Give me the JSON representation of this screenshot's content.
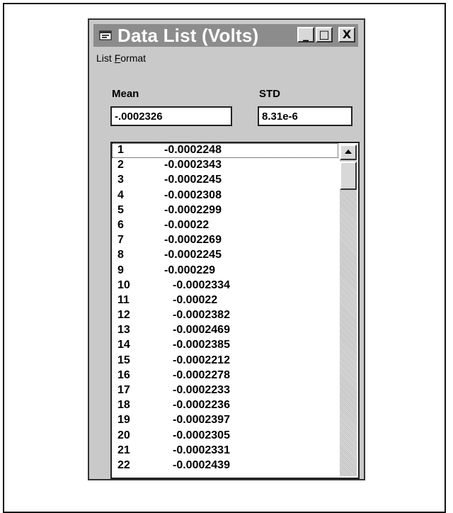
{
  "window": {
    "title": "Data List (Volts)",
    "controls": {
      "minimize": "_",
      "maximize": "□",
      "close": "X"
    }
  },
  "menu": {
    "list": "List",
    "format_prefix": "F",
    "format_rest": "ormat"
  },
  "stats": {
    "mean_label": "Mean",
    "mean_value": "-.0002326",
    "std_label": "STD",
    "std_value": "8.31e-6"
  },
  "list": {
    "rows": [
      {
        "index": "1",
        "value": "-0.0002248"
      },
      {
        "index": "2",
        "value": "-0.0002343"
      },
      {
        "index": "3",
        "value": "-0.0002245"
      },
      {
        "index": "4",
        "value": "-0.0002308"
      },
      {
        "index": "5",
        "value": "-0.0002299"
      },
      {
        "index": "6",
        "value": "-0.00022"
      },
      {
        "index": "7",
        "value": "-0.0002269"
      },
      {
        "index": "8",
        "value": "-0.0002245"
      },
      {
        "index": "9",
        "value": "-0.000229"
      },
      {
        "index": "10",
        "value": "-0.0002334"
      },
      {
        "index": "11",
        "value": "-0.00022"
      },
      {
        "index": "12",
        "value": "-0.0002382"
      },
      {
        "index": "13",
        "value": "-0.0002469"
      },
      {
        "index": "14",
        "value": "-0.0002385"
      },
      {
        "index": "15",
        "value": "-0.0002212"
      },
      {
        "index": "16",
        "value": "-0.0002278"
      },
      {
        "index": "17",
        "value": "-0.0002233"
      },
      {
        "index": "18",
        "value": "-0.0002236"
      },
      {
        "index": "19",
        "value": "-0.0002397"
      },
      {
        "index": "20",
        "value": "-0.0002305"
      },
      {
        "index": "21",
        "value": "-0.0002331"
      },
      {
        "index": "22",
        "value": "-0.0002439"
      }
    ]
  },
  "colors": {
    "titlebar": "#8c8c8c",
    "window_bg": "#c9c9c9",
    "list_bg": "#ffffff"
  }
}
